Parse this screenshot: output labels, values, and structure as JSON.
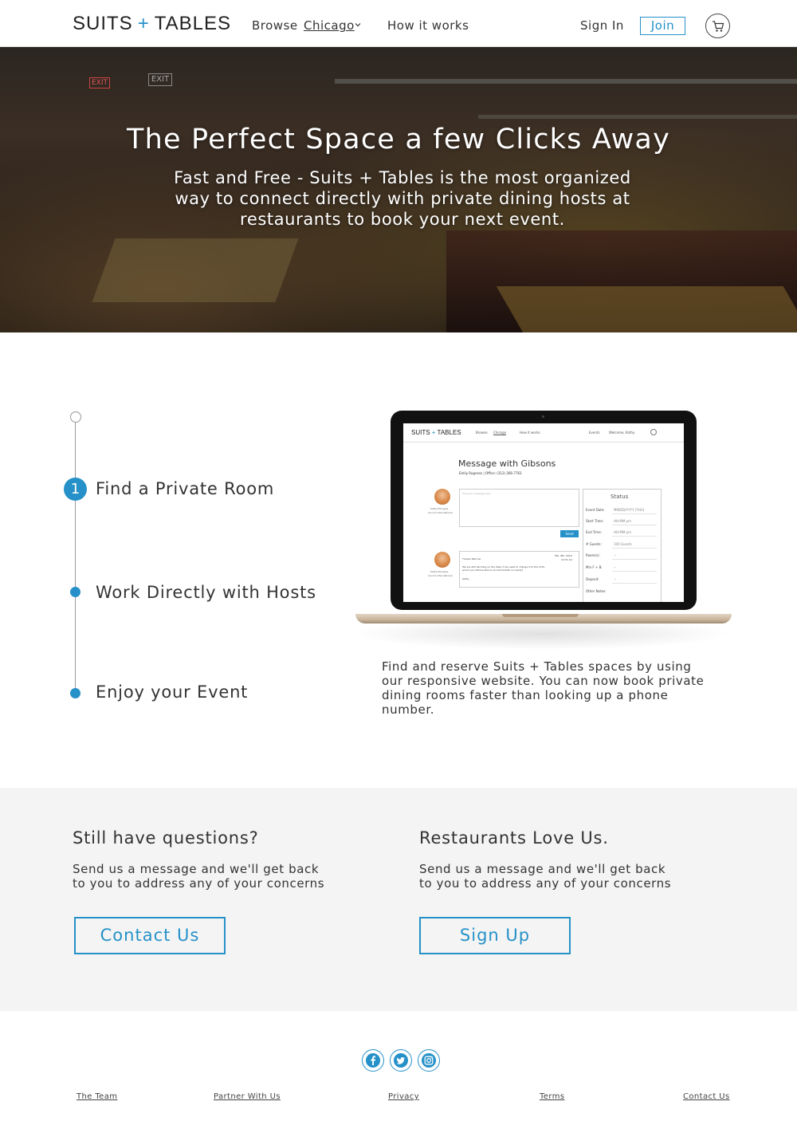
{
  "header": {
    "logo_left": "SUITS",
    "logo_plus": "+",
    "logo_right": "TABLES",
    "browse_label": "Browse",
    "city_label": "Chicago",
    "how_label": "How it works",
    "signin_label": "Sign In",
    "join_label": "Join",
    "cart_icon": "cart-icon"
  },
  "hero": {
    "title": "The Perfect Space a few Clicks Away",
    "subtitle": "Fast and Free - Suits + Tables is the most organized way to connect directly with private dining hosts at restaurants to book your next event.",
    "exit_sign_1": "EXIT",
    "exit_sign_2": "EXIT"
  },
  "steps": {
    "active_number": "1",
    "items": [
      {
        "label": "Find a Private Room"
      },
      {
        "label": "Work Directly with Hosts"
      },
      {
        "label": "Enjoy your Event"
      }
    ]
  },
  "laptop": {
    "screen": {
      "logo_left": "SUITS",
      "logo_plus": "+",
      "logo_right": "TABLES",
      "browse": "Browse",
      "city": "Chicago",
      "how": "How it works",
      "events": "Events",
      "welcome": "Welcome, Kathy",
      "heading": "Message with Gibsons",
      "subheading": "Emily Rugness | Office: (312) 266-7763",
      "avatar_caption_1": "Kathy Perogies",
      "avatar_caption_2": "Lincoln International",
      "placeholder": "Add your message here",
      "send_label": "Send",
      "msg_greeting": "Thanks Marcus!",
      "msg_date": "Feb. 8th, 2016",
      "msg_time": "10:31 am",
      "msg_body_1": "We are still deciding on the date. If we need to change it to the 11th,",
      "msg_body_2": "would you still be able to accommodate our party?",
      "msg_sign": "Kathy",
      "status_title": "Status",
      "status_rows": [
        {
          "label": "Event Date:",
          "value": "MM/DD/YYYY (THU)"
        },
        {
          "label": "Start Time:",
          "value": "HH:MM pm"
        },
        {
          "label": "End Time:",
          "value": "HH:MM pm"
        },
        {
          "label": "# Guests:",
          "value": "100 Guests"
        },
        {
          "label": "Room(s):",
          "value": "--"
        },
        {
          "label": "Min F + B:",
          "value": "--"
        },
        {
          "label": "Deposit:",
          "value": "--"
        },
        {
          "label": "Other Notes:",
          "value": ""
        }
      ]
    },
    "caption": "Find and reserve Suits + Tables spaces by using our responsive website. You can now book private dining rooms faster than looking up a phone number."
  },
  "questions": {
    "title": "Still have questions?",
    "text": "Send us a message and we'll get back to you to address any of your concerns",
    "button": "Contact Us"
  },
  "restaurants": {
    "title": "Restaurants Love Us.",
    "text": "Send us a message and we'll get back to you to address any of your concerns",
    "button": "Sign Up"
  },
  "footer": {
    "social_icons": [
      "facebook-icon",
      "twitter-icon",
      "instagram-icon"
    ],
    "links": [
      "The Team",
      "Partner With Us",
      "Privacy",
      "Terms",
      "Contact Us"
    ]
  },
  "colors": {
    "accent": "#2591c8",
    "text": "#333333",
    "band_bg": "#f4f4f4"
  }
}
